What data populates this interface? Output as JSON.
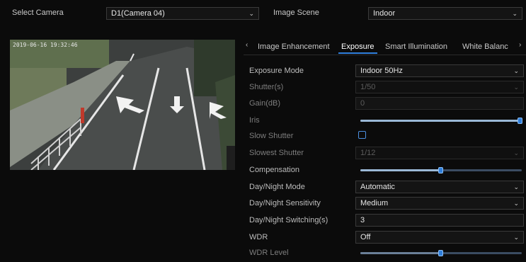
{
  "top_bar": {
    "select_camera_label": "Select Camera",
    "camera_value": "D1(Camera 04)",
    "image_scene_label": "Image Scene",
    "image_scene_value": "Indoor"
  },
  "preview": {
    "timestamp": "2019-06-16 19:32:46"
  },
  "tabs": [
    {
      "label": "Image Enhancement"
    },
    {
      "label": "Exposure"
    },
    {
      "label": "Smart Illumination"
    },
    {
      "label": "White Balanc"
    }
  ],
  "settings": {
    "exposure_mode": {
      "label": "Exposure Mode",
      "value": "Indoor 50Hz"
    },
    "shutter": {
      "label": "Shutter(s)",
      "value": "1/50"
    },
    "gain": {
      "label": "Gain(dB)",
      "value": "0"
    },
    "iris": {
      "label": "Iris",
      "level_percent": 100
    },
    "slow_shutter": {
      "label": "Slow Shutter",
      "checked": false
    },
    "slowest_shutter": {
      "label": "Slowest Shutter",
      "value": "1/12"
    },
    "compensation": {
      "label": "Compensation",
      "level_percent": 50
    },
    "day_night_mode": {
      "label": "Day/Night Mode",
      "value": "Automatic"
    },
    "day_night_sensitivity": {
      "label": "Day/Night Sensitivity",
      "value": "Medium"
    },
    "day_night_switching": {
      "label": "Day/Night Switching(s)",
      "value": "3"
    },
    "wdr": {
      "label": "WDR",
      "value": "Off"
    },
    "wdr_level": {
      "label": "WDR Level",
      "level_percent": 50
    }
  },
  "colors": {
    "background": "#0b0b0b",
    "accent": "#2f7fdc"
  }
}
